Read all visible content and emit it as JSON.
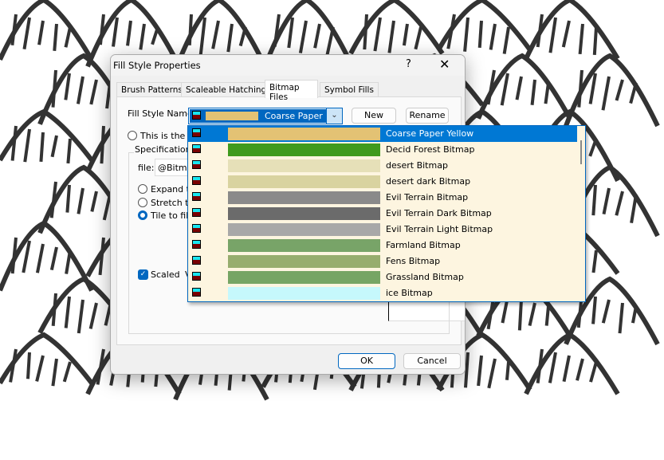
{
  "dialog": {
    "title": "Fill Style Properties",
    "help_label": "?",
    "close_label": "✕"
  },
  "tabs": [
    {
      "label": "Brush Patterns"
    },
    {
      "label": "Scaleable Hatching"
    },
    {
      "label": "Bitmap Files",
      "active": true
    },
    {
      "label": "Symbol Fills"
    }
  ],
  "fill_style": {
    "label": "Fill Style Name:",
    "value": "Coarse Paper Y",
    "new_label": "New",
    "rename_label": "Rename"
  },
  "current_radio_label": "This is the cu",
  "specs": {
    "group_label": "Specifications",
    "file_label": "file:",
    "file_value": "@Bitmap",
    "options": [
      {
        "label": "Expand to",
        "checked": false
      },
      {
        "label": "Stretch to",
        "checked": false
      },
      {
        "label": "Tile to fill",
        "checked": true
      }
    ],
    "scaled_label": "Scaled",
    "scaled_checked": true,
    "scaled_suffix": "V"
  },
  "dropdown": {
    "items": [
      {
        "label": "Coarse Paper Yellow",
        "color": "#e3c274",
        "selected": true
      },
      {
        "label": "Decid Forest Bitmap",
        "color": "#3f9a1e"
      },
      {
        "label": "desert Bitmap",
        "color": "#e6e0b8"
      },
      {
        "label": "desert dark Bitmap",
        "color": "#d9d3a0"
      },
      {
        "label": "Evil Terrain Bitmap",
        "color": "#8a8a8a"
      },
      {
        "label": "Evil Terrain Dark Bitmap",
        "color": "#6b6b6b"
      },
      {
        "label": "Evil Terrain Light Bitmap",
        "color": "#a8a8a8"
      },
      {
        "label": "Farmland Bitmap",
        "color": "#78a468"
      },
      {
        "label": "Fens Bitmap",
        "color": "#97ad6e"
      },
      {
        "label": "Grassland Bitmap",
        "color": "#76a564"
      },
      {
        "label": "ice Bitmap",
        "color": "#c6f8fc"
      }
    ]
  },
  "footer": {
    "ok_label": "OK",
    "cancel_label": "Cancel"
  }
}
